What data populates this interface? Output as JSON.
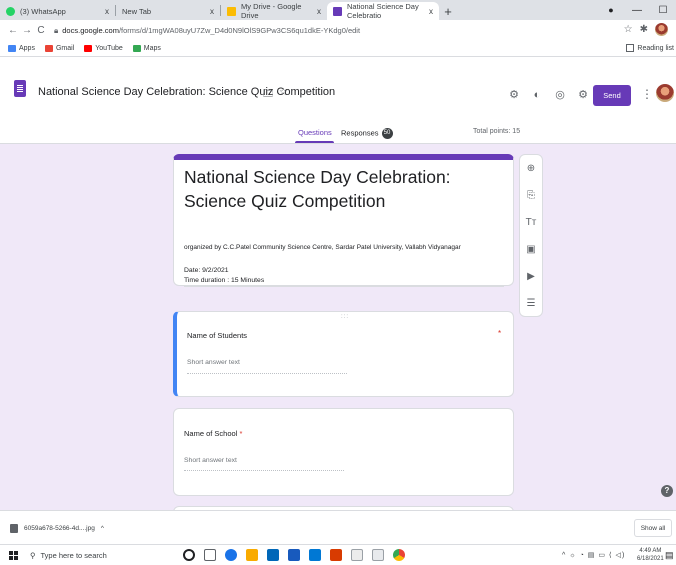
{
  "browser": {
    "tabs": [
      {
        "label": "(3) WhatsApp",
        "icon": "whatsapp-icon",
        "color": "#25d366"
      },
      {
        "label": "New Tab",
        "icon": "blank-icon",
        "color": ""
      },
      {
        "label": "My Drive - Google Drive",
        "icon": "drive-icon",
        "color": "#fbbc04"
      },
      {
        "label": "National Science Day Celebratio",
        "icon": "forms-icon",
        "color": "#673ab7"
      }
    ],
    "close_glyph": "x",
    "new_tab_glyph": "+",
    "window_controls": [
      "—",
      "☐",
      "✕"
    ],
    "url_host": "docs.google.com",
    "url_path": "/forms/d/1mgWA08uyU7Zw_D4d0N9lOlS9GPw3CS6qu1dkE-YKdg0/edit",
    "bookmarks": [
      {
        "label": "Apps",
        "color": "#4285f4"
      },
      {
        "label": "Gmail",
        "color": "#ea4335"
      },
      {
        "label": "YouTube",
        "color": "#ff0000"
      },
      {
        "label": "Maps",
        "color": "#34a853"
      }
    ],
    "reading_list": "Reading list"
  },
  "form": {
    "doc_title": "National Science Day Celebration: Science Quiz Competition",
    "send_label": "Send",
    "tabs": {
      "questions": "Questions",
      "responses": "Responses",
      "responses_count": "50"
    },
    "total_points": "Total points: 15",
    "title_card": {
      "title": "National Science Day Celebration: Science Quiz Competition",
      "organizer": "organized by C.C.Patel Community Science Centre, Sardar Patel University, Vallabh Vidyanagar",
      "date": "Date: 9/2/2021",
      "duration": "Time duration : 15 Minutes"
    },
    "questions": [
      {
        "label": "Name of Students",
        "required_mark": "*",
        "placeholder": "Short answer text"
      },
      {
        "label": "Name of School",
        "required_mark": "*",
        "placeholder": "Short answer text"
      }
    ],
    "drag_handle": ":::",
    "toolbar_icons": [
      "add-question-icon",
      "import-questions-icon",
      "add-title-icon",
      "add-image-icon",
      "add-video-icon",
      "add-section-icon"
    ],
    "toolbar_glyphs": [
      "⊕",
      "⎘",
      "Tт",
      "▣",
      "▶",
      "☰"
    ]
  },
  "downloads": {
    "file": "6059a678-5266-4d....jpg",
    "caret": "^",
    "show_all": "Show all"
  },
  "taskbar": {
    "search_placeholder": "Type here to search",
    "time": "4:49 AM",
    "date": "6/18/2021",
    "tray": "^ ☼ ◔ ▤ ▭ ⟨ ◁)"
  }
}
